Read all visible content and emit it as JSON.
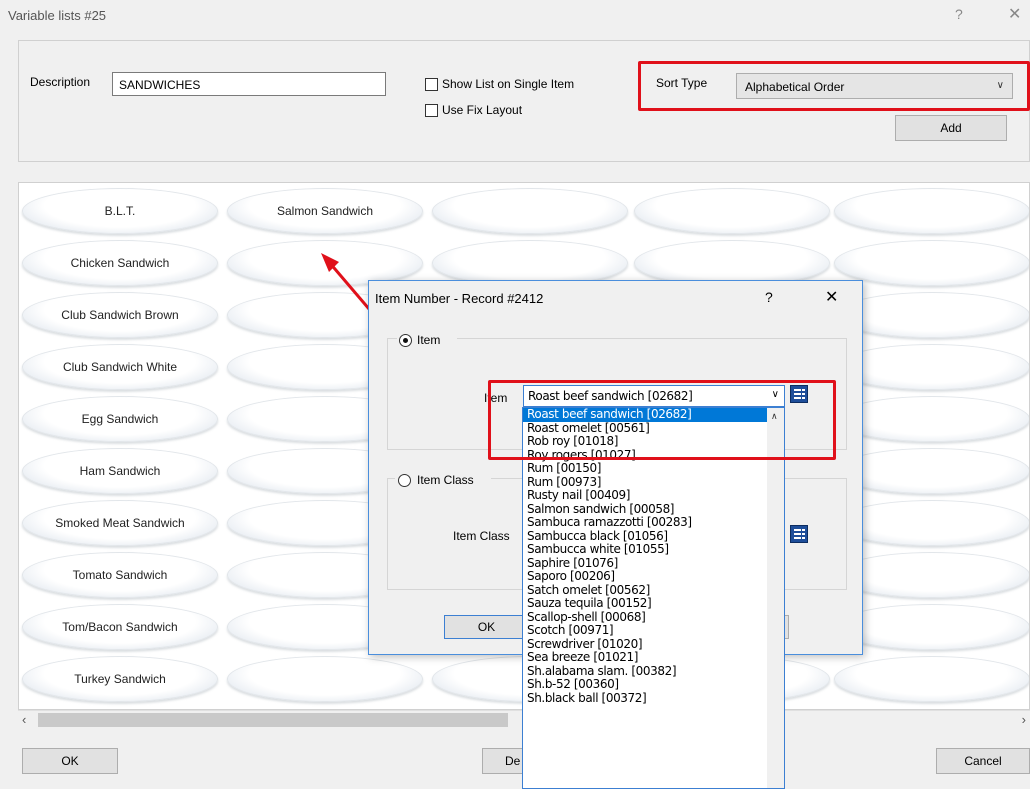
{
  "window": {
    "title": "Variable lists #25",
    "help": "?",
    "close": "✕"
  },
  "form": {
    "description_label": "Description",
    "description_value": "SANDWICHES",
    "show_list_label": "Show List on Single Item",
    "fix_layout_label": "Use Fix Layout",
    "sort_type_label": "Sort Type",
    "sort_type_value": "Alphabetical Order",
    "add_label": "Add"
  },
  "grid": {
    "col1": [
      "B.L.T.",
      "Chicken Sandwich",
      "Club Sandwich Brown",
      "Club Sandwich White",
      "Egg Sandwich",
      "Ham Sandwich",
      "Smoked Meat Sandwich",
      "Tomato Sandwich",
      "Tom/Bacon Sandwich",
      "Turkey Sandwich"
    ],
    "col2_first": "Salmon Sandwich"
  },
  "dialog": {
    "title": "Item Number - Record #2412",
    "help": "?",
    "close": "✕",
    "item_radio_label": "Item",
    "item_field_label": "Item",
    "item_value": "Roast beef sandwich [02682]",
    "item_class_radio_label": "Item Class",
    "item_class_field_label": "Item Class",
    "ok_label": "OK"
  },
  "dropdown_options": [
    "Roast beef sandwich [02682]",
    "Roast omelet [00561]",
    "Rob roy [01018]",
    "Roy rogers [01027]",
    "Rum [00150]",
    "Rum [00973]",
    "Rusty nail [00409]",
    "Salmon sandwich [00058]",
    "Sambuca ramazzotti [00283]",
    "Sambucca black [01056]",
    "Sambucca white [01055]",
    "Saphire [01076]",
    "Saporo [00206]",
    "Satch omelet [00562]",
    "Sauza tequila [00152]",
    "Scallop-shell [00068]",
    "Scotch [00971]",
    "Screwdriver [01020]",
    "Sea breeze [01021]",
    "Sh.alabama slam. [00382]",
    "Sh.b-52 [00360]",
    "Sh.black ball [00372]"
  ],
  "footer": {
    "ok_label": "OK",
    "delete_label": "De",
    "cancel_label": "Cancel"
  },
  "colors": {
    "highlight": "#e0101a",
    "selection": "#0078d7",
    "dialog_border": "#4a8edc"
  }
}
